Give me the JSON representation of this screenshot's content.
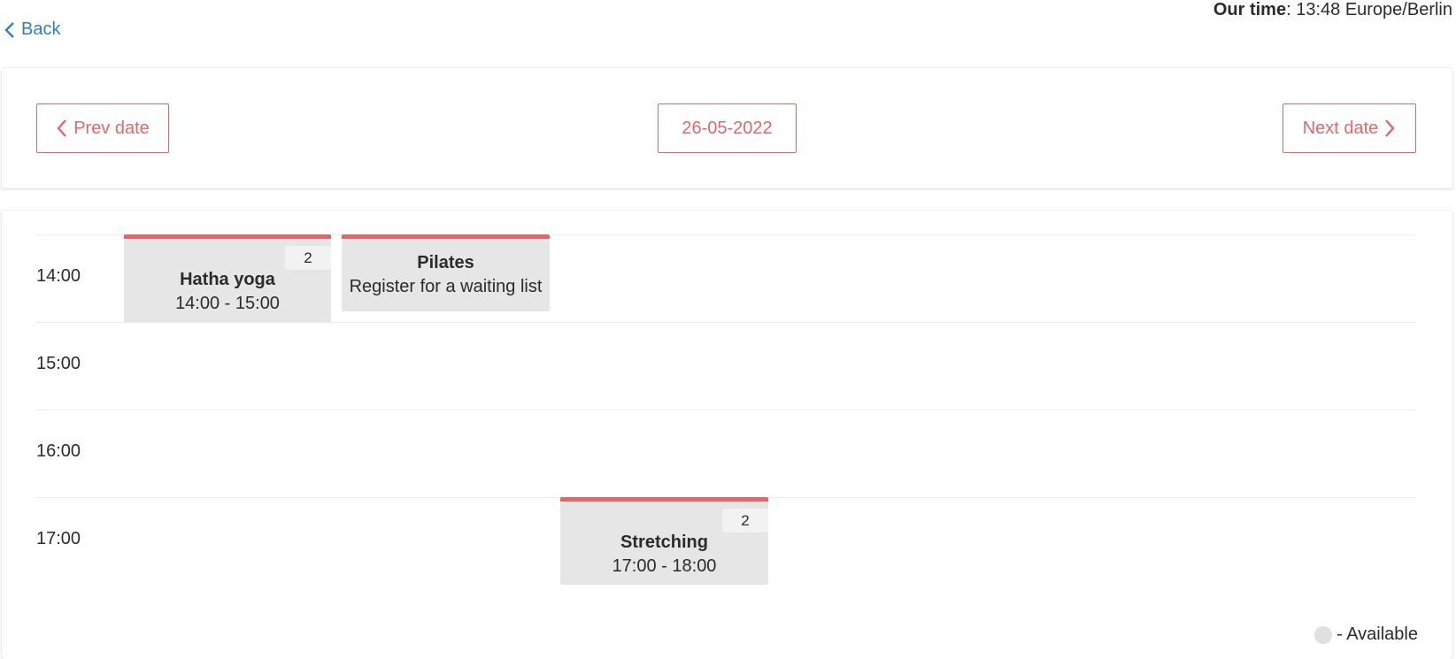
{
  "header": {
    "back_label": "Back",
    "time_label": "Our time",
    "time_value": ": 13:48 Europe/Berlin"
  },
  "date_nav": {
    "prev_label": "Prev date",
    "current_date": "26-05-2022",
    "next_label": "Next date"
  },
  "schedule": {
    "hours": [
      "14:00",
      "15:00",
      "16:00",
      "17:00"
    ],
    "events": [
      {
        "title": "Hatha yoga",
        "subtitle": "14:00 - 15:00",
        "count": "2"
      },
      {
        "title": "Pilates",
        "subtitle": "Register for a waiting list"
      },
      {
        "title": "Stretching",
        "subtitle": "17:00 - 18:00",
        "count": "2"
      }
    ]
  },
  "legend": {
    "label": "- Available"
  },
  "colors": {
    "accent": "#e06868",
    "link": "#2f7fc1",
    "event_bg": "#e6e6e6"
  }
}
